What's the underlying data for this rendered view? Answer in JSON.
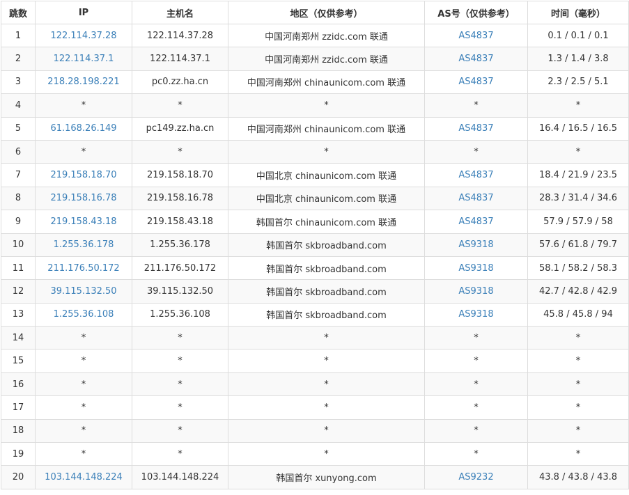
{
  "colors": {
    "link": "#3a7fb8",
    "text": "#333333",
    "border": "#dddddd",
    "stripe": "#f9f9f9"
  },
  "headers": {
    "hop": "跳数",
    "ip": "IP",
    "host": "主机名",
    "region": "地区（仅供参考）",
    "as": "AS号（仅供参考）",
    "time": "时间（毫秒）"
  },
  "rows": [
    {
      "hop": "1",
      "ip": "122.114.37.28",
      "host": "122.114.37.28",
      "region": "中国河南郑州 zzidc.com 联通",
      "as": "AS4837",
      "time": "0.1 / 0.1 / 0.1"
    },
    {
      "hop": "2",
      "ip": "122.114.37.1",
      "host": "122.114.37.1",
      "region": "中国河南郑州 zzidc.com 联通",
      "as": "AS4837",
      "time": "1.3 / 1.4 / 3.8"
    },
    {
      "hop": "3",
      "ip": "218.28.198.221",
      "host": "pc0.zz.ha.cn",
      "region": "中国河南郑州 chinaunicom.com 联通",
      "as": "AS4837",
      "time": "2.3 / 2.5 / 5.1"
    },
    {
      "hop": "4",
      "ip": "*",
      "host": "*",
      "region": "*",
      "as": "*",
      "time": "*"
    },
    {
      "hop": "5",
      "ip": "61.168.26.149",
      "host": "pc149.zz.ha.cn",
      "region": "中国河南郑州 chinaunicom.com 联通",
      "as": "AS4837",
      "time": "16.4 / 16.5 / 16.5"
    },
    {
      "hop": "6",
      "ip": "*",
      "host": "*",
      "region": "*",
      "as": "*",
      "time": "*"
    },
    {
      "hop": "7",
      "ip": "219.158.18.70",
      "host": "219.158.18.70",
      "region": "中国北京 chinaunicom.com 联通",
      "as": "AS4837",
      "time": "18.4 / 21.9 / 23.5"
    },
    {
      "hop": "8",
      "ip": "219.158.16.78",
      "host": "219.158.16.78",
      "region": "中国北京 chinaunicom.com 联通",
      "as": "AS4837",
      "time": "28.3 / 31.4 / 34.6"
    },
    {
      "hop": "9",
      "ip": "219.158.43.18",
      "host": "219.158.43.18",
      "region": "韩国首尔 chinaunicom.com 联通",
      "as": "AS4837",
      "time": "57.9 / 57.9 / 58"
    },
    {
      "hop": "10",
      "ip": "1.255.36.178",
      "host": "1.255.36.178",
      "region": "韩国首尔 skbroadband.com",
      "as": "AS9318",
      "time": "57.6 / 61.8 / 79.7"
    },
    {
      "hop": "11",
      "ip": "211.176.50.172",
      "host": "211.176.50.172",
      "region": "韩国首尔 skbroadband.com",
      "as": "AS9318",
      "time": "58.1 / 58.2 / 58.3"
    },
    {
      "hop": "12",
      "ip": "39.115.132.50",
      "host": "39.115.132.50",
      "region": "韩国首尔 skbroadband.com",
      "as": "AS9318",
      "time": "42.7 / 42.8 / 42.9"
    },
    {
      "hop": "13",
      "ip": "1.255.36.108",
      "host": "1.255.36.108",
      "region": "韩国首尔 skbroadband.com",
      "as": "AS9318",
      "time": "45.8 / 45.8 / 94"
    },
    {
      "hop": "14",
      "ip": "*",
      "host": "*",
      "region": "*",
      "as": "*",
      "time": "*"
    },
    {
      "hop": "15",
      "ip": "*",
      "host": "*",
      "region": "*",
      "as": "*",
      "time": "*"
    },
    {
      "hop": "16",
      "ip": "*",
      "host": "*",
      "region": "*",
      "as": "*",
      "time": "*"
    },
    {
      "hop": "17",
      "ip": "*",
      "host": "*",
      "region": "*",
      "as": "*",
      "time": "*"
    },
    {
      "hop": "18",
      "ip": "*",
      "host": "*",
      "region": "*",
      "as": "*",
      "time": "*"
    },
    {
      "hop": "19",
      "ip": "*",
      "host": "*",
      "region": "*",
      "as": "*",
      "time": "*"
    },
    {
      "hop": "20",
      "ip": "103.144.148.224",
      "host": "103.144.148.224",
      "region": "韩国首尔 xunyong.com",
      "as": "AS9232",
      "time": "43.8 / 43.8 / 43.8"
    }
  ]
}
